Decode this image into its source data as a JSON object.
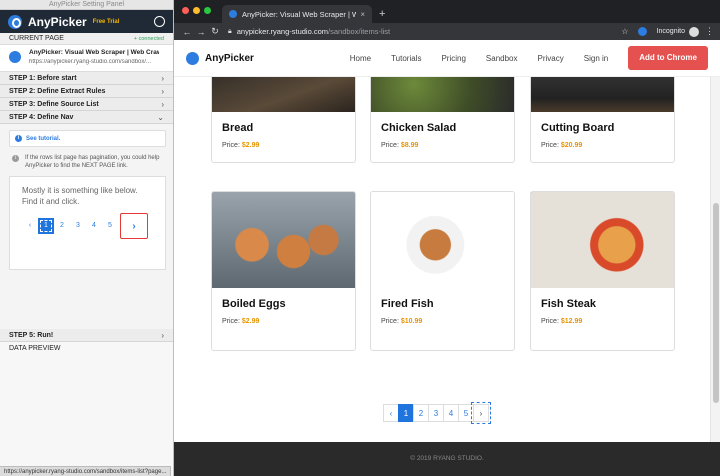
{
  "panel": {
    "window_title": "AnyPicker Setting Panel",
    "brand": "AnyPicker",
    "trial_badge": "Free Trial",
    "current_page_label": "CURRENT PAGE",
    "connected": "+ connected",
    "page_title": "AnyPicker: Visual Web Scraper | Web Crawl...",
    "page_url": "https://anypicker.ryang-studio.com/sandbox/...",
    "steps": [
      {
        "label": "STEP 1: Before start"
      },
      {
        "label": "STEP 2: Define Extract Rules"
      },
      {
        "label": "STEP 3: Define Source List"
      },
      {
        "label": "STEP 4: Define Nav"
      },
      {
        "label": "STEP 5: Run!"
      }
    ],
    "tutorial_link": "See tutorial.",
    "pagination_note": "If the rows list page has pagination, you could help AnyPicker to find the NEXT PAGE link.",
    "demo_message": "Mostly it is something like below. Find it and click.",
    "demo_pages": [
      "1",
      "2",
      "3",
      "4",
      "5"
    ],
    "data_preview_label": "DATA PREVIEW"
  },
  "browser": {
    "tab_title": "AnyPicker: Visual Web Scraper | Web Crawl",
    "url_host": "anypicker.ryang-studio.com",
    "url_path": "/sandbox/items-list",
    "incognito": "Incognito",
    "status_url": "https://anypicker.ryang-studio.com/sandbox/items-list?page..."
  },
  "site": {
    "brand": "AnyPicker",
    "nav": [
      "Home",
      "Tutorials",
      "Pricing",
      "Sandbox",
      "Privacy",
      "Sign in"
    ],
    "cta": "Add to Chrome",
    "price_label": "Price:",
    "items": [
      {
        "name": "Bread",
        "price": "$2.99"
      },
      {
        "name": "Chicken Salad",
        "price": "$8.99"
      },
      {
        "name": "Cutting Board",
        "price": "$20.99"
      },
      {
        "name": "Boiled Eggs",
        "price": "$2.99"
      },
      {
        "name": "Fired Fish",
        "price": "$10.99"
      },
      {
        "name": "Fish Steak",
        "price": "$12.99"
      }
    ],
    "pages": [
      "1",
      "2",
      "3",
      "4",
      "5"
    ],
    "footer": "© 2019 RYANG STUDIO."
  },
  "colors": {
    "accent": "#1f74dd",
    "price": "#e69500",
    "cta": "#e4514f",
    "highlight": "#e53935"
  }
}
